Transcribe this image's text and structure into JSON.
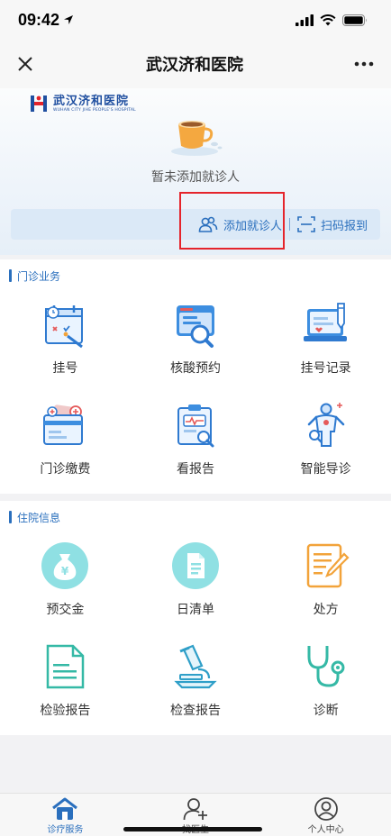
{
  "status_bar": {
    "time": "09:42"
  },
  "nav": {
    "title": "武汉济和医院"
  },
  "hero": {
    "logo_cn": "武汉济和医院",
    "logo_en": "WUHAN CITY JIHE PEOPLE'S HOSPITAL",
    "empty_text": "暂未添加就诊人",
    "add_patient_label": "添加就诊人",
    "scan_label": "扫码报到"
  },
  "outpatient": {
    "title": "门诊业务",
    "items": [
      {
        "label": "挂号",
        "icon": "calendar-register-icon"
      },
      {
        "label": "核酸预约",
        "icon": "browser-search-icon"
      },
      {
        "label": "挂号记录",
        "icon": "laptop-record-icon"
      },
      {
        "label": "门诊缴费",
        "icon": "payment-card-icon"
      },
      {
        "label": "看报告",
        "icon": "clipboard-report-icon"
      },
      {
        "label": "智能导诊",
        "icon": "body-guide-icon"
      }
    ]
  },
  "inpatient": {
    "title": "住院信息",
    "items": [
      {
        "label": "预交金",
        "icon": "money-bag-icon"
      },
      {
        "label": "日清单",
        "icon": "daily-list-icon"
      },
      {
        "label": "处方",
        "icon": "prescription-icon"
      },
      {
        "label": "检验报告",
        "icon": "test-report-icon"
      },
      {
        "label": "检查报告",
        "icon": "microscope-icon"
      },
      {
        "label": "诊断",
        "icon": "stethoscope-icon"
      }
    ]
  },
  "tabbar": {
    "tabs": [
      {
        "label": "诊疗服务",
        "icon": "home-icon"
      },
      {
        "label": "找医生",
        "icon": "add-user-icon"
      },
      {
        "label": "个人中心",
        "icon": "user-icon"
      }
    ]
  },
  "colors": {
    "accent": "#2a6fbd",
    "highlight": "#e5242b",
    "teal": "#43c2c7",
    "orange": "#f2a33a"
  }
}
